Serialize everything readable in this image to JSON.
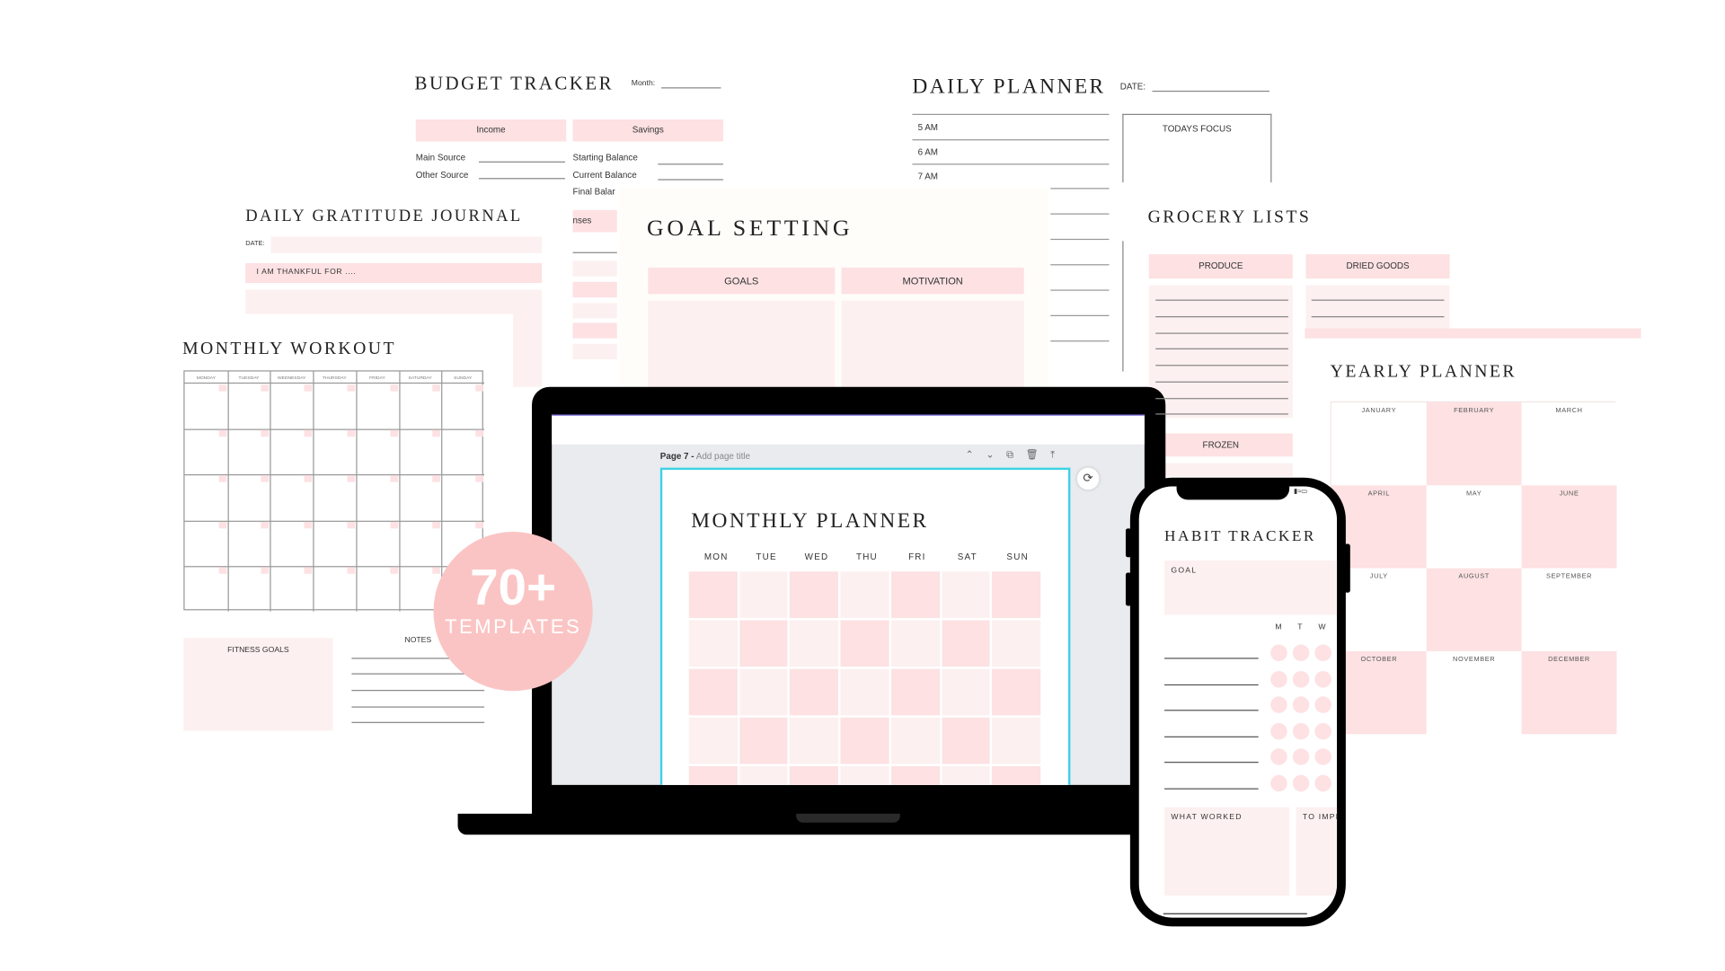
{
  "budget": {
    "title": "BUDGET TRACKER",
    "month_label": "Month:",
    "income": "Income",
    "savings": "Savings",
    "rows_left": [
      "Main Source",
      "Other Source"
    ],
    "rows_right": [
      "Starting Balance",
      "Current Balance",
      "Final Balar"
    ],
    "expenses_fragment": "nses"
  },
  "daily_planner": {
    "title": "DAILY PLANNER",
    "date_label": "DATE:",
    "times": [
      "5 AM",
      "6 AM",
      "7 AM"
    ],
    "focus": "TODAYS FOCUS"
  },
  "gratitude": {
    "title": "DAILY GRATITUDE JOURNAL",
    "date_label": "DATE:",
    "thankful": "I AM THANKFUL FOR ...."
  },
  "goal": {
    "title": "GOAL SETTING",
    "goals": "GOALS",
    "motivation": "MOTIVATION"
  },
  "grocery": {
    "title": "GROCERY LISTS",
    "produce": "PRODUCE",
    "dried": "DRIED GOODS",
    "frozen": "FROZEN"
  },
  "yearly": {
    "title": "YEARLY PLANNER",
    "months": [
      "JANUARY",
      "FEBRUARY",
      "MARCH",
      "APRIL",
      "MAY",
      "JUNE",
      "JULY",
      "AUGUST",
      "SEPTEMBER",
      "OCTOBER",
      "NOVEMBER",
      "DECEMBER"
    ]
  },
  "workout": {
    "title": "MONTHLY WORKOUT",
    "days": [
      "MONDAY",
      "TUESDAY",
      "WEDNESDAY",
      "THURSDAY",
      "FRIDAY",
      "SATURDAY",
      "SUNDAY"
    ],
    "fitness_goals": "FITNESS GOALS",
    "notes": "NOTES"
  },
  "badge": {
    "count": "70+",
    "label": "TEMPLATES",
    "color": "#fbc4c4"
  },
  "editor": {
    "page_label": "Page 7 -",
    "page_title_placeholder": "Add page title",
    "accent": "#3ed2e6",
    "icons": [
      "chevron-up-icon",
      "chevron-down-icon",
      "duplicate-icon",
      "trash-icon",
      "add-page-icon",
      "comment-add-icon"
    ]
  },
  "monthly": {
    "title": "MONTHLY PLANNER",
    "days": [
      "MON",
      "TUE",
      "WED",
      "THU",
      "FRI",
      "SAT",
      "SUN"
    ]
  },
  "habit": {
    "title": "HABIT TRACKER",
    "goal": "GOAL",
    "days": [
      "M",
      "T",
      "W"
    ],
    "what_worked": "WHAT WORKED",
    "to_improve": "TO IMPR",
    "status_time": "30"
  }
}
